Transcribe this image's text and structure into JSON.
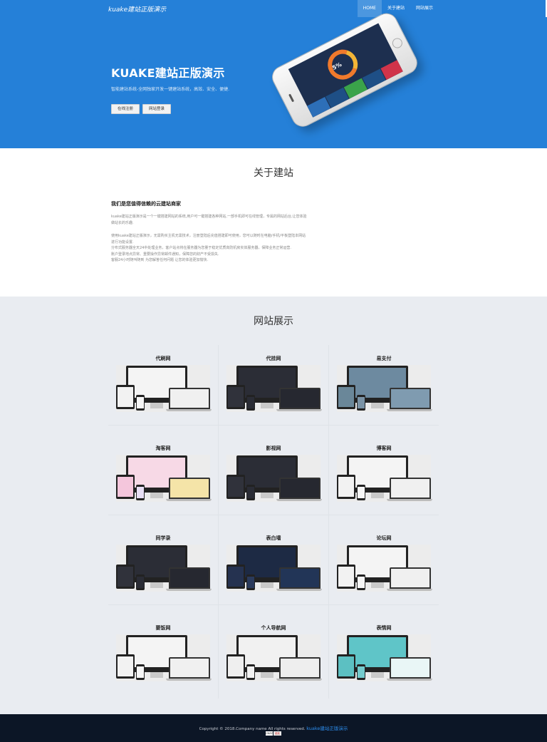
{
  "nav": {
    "brand": "kuake建站正版演示",
    "links": [
      {
        "label": "HOME",
        "active": true
      },
      {
        "label": "关于建站",
        "active": false
      },
      {
        "label": "网站展示",
        "active": false
      }
    ]
  },
  "hero": {
    "title": "KUAKE建站正版演示",
    "subtitle": "智能建站系统-全网独家开发一键建站系统，高效、安全、便捷.",
    "register_label": "在线注册",
    "login_label": "网站登录",
    "phone_reading": "5%",
    "bg_color": "#2580d8"
  },
  "about": {
    "title": "关于建站",
    "heading": "我们是您值得信赖的云建站商家",
    "p1": "kuake建站正版演示是一个一键搭建网站的系统,用户可一键搭建各种网站,一部手机即可在线管理，专属的网站后台,让您体验做站长的乐趣.",
    "p2_lines": [
      "使用kuake建站正版演示，无需购买主机无需技术，注册登陆后充值搭建即可使用，您可以随时在电脑/手机/平板登陆本网站进行功能设置.",
      "分布式服务器全天24中处理业务，客户站点将在服务器为您量于稳定优质高防机房实体服务器，保障业务正常运营.",
      "账户登录地点异常、重要操作异常邮件通知，保障您的财产不受损失.",
      "客服24小时随叫随到 为您解答任何问题 让您的体验更加愉快."
    ]
  },
  "showcase": {
    "title": "网站展示",
    "items": [
      {
        "name": "代刷网",
        "theme": "light"
      },
      {
        "name": "代挂网",
        "theme": "dark"
      },
      {
        "name": "易支付",
        "theme": "landscape"
      },
      {
        "name": "淘客网",
        "theme": "colorful"
      },
      {
        "name": "影视网",
        "theme": "dark"
      },
      {
        "name": "博客网",
        "theme": "light"
      },
      {
        "name": "同学录",
        "theme": "dark"
      },
      {
        "name": "表白墙",
        "theme": "night"
      },
      {
        "name": "论坛网",
        "theme": "light"
      },
      {
        "name": "要饭网",
        "theme": "light"
      },
      {
        "name": "个人导航网",
        "theme": "dots"
      },
      {
        "name": "表情网",
        "theme": "teal"
      }
    ]
  },
  "footer": {
    "copyright": "Copyright © 2018.Company name All rights reserved.",
    "link_text": "kuake建站正版演示",
    "badge_a": "CNZZ",
    "badge_b": "站长"
  }
}
